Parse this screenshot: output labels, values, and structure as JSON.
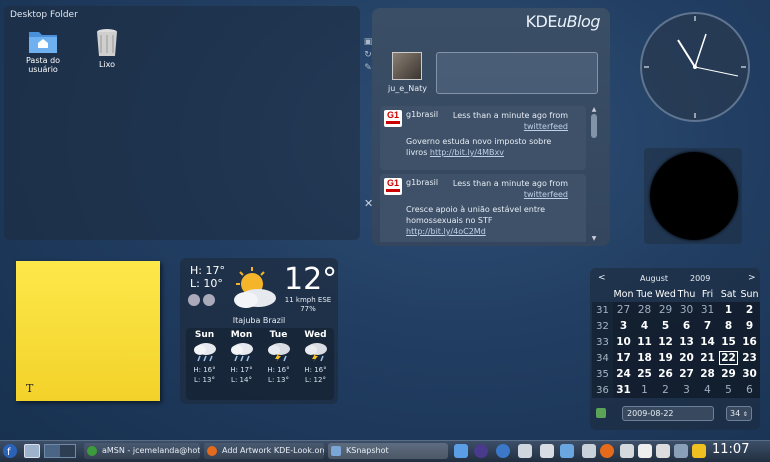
{
  "desktop_folder": {
    "title": "Desktop Folder",
    "icons": [
      {
        "label": "Pasta do usuário",
        "icon": "home-folder-icon"
      },
      {
        "label": "Lixo",
        "icon": "trash-icon"
      }
    ]
  },
  "microblog": {
    "logo_a": "KDE",
    "logo_b": "uBlog",
    "user": "ju_e_Naty",
    "posts": [
      {
        "user": "g1brasil",
        "time": "Less than a minute ago from",
        "source": "twitterfeed",
        "text": "Governo estuda novo imposto sobre livros",
        "link": "http://bit.ly/4MBxv"
      },
      {
        "user": "g1brasil",
        "time": "Less than a minute ago from",
        "source": "twitterfeed",
        "text": "Cresce apoio à união estável entre homossexuais no STF",
        "link": "http://bit.ly/4oC2Md"
      }
    ]
  },
  "weather": {
    "high": "H: 17°",
    "low": "L: 10°",
    "temp": "12°",
    "wind": "11 kmph ESE",
    "humidity": "77%",
    "city": "Itajuba Brazil",
    "days": [
      {
        "name": "Sun",
        "high": "H: 16°",
        "low": "L: 13°",
        "icon": "rain-icon"
      },
      {
        "name": "Mon",
        "high": "H: 17°",
        "low": "L: 14°",
        "icon": "rain-icon"
      },
      {
        "name": "Tue",
        "high": "H: 16°",
        "low": "L: 13°",
        "icon": "storm-icon"
      },
      {
        "name": "Wed",
        "high": "H: 16°",
        "low": "L: 12°",
        "icon": "storm-icon"
      }
    ]
  },
  "sticky": {
    "cursor": "T"
  },
  "calendar": {
    "prev": "<",
    "next": ">",
    "month": "August",
    "year": "2009",
    "headers": [
      "Mon",
      "Tue",
      "Wed",
      "Thu",
      "Fri",
      "Sat",
      "Sun"
    ],
    "weeks": [
      {
        "wk": "31",
        "days": [
          "27",
          "28",
          "29",
          "30",
          "31",
          "1",
          "2"
        ],
        "cur_from": 5
      },
      {
        "wk": "32",
        "days": [
          "3",
          "4",
          "5",
          "6",
          "7",
          "8",
          "9"
        ],
        "cur_from": 0
      },
      {
        "wk": "33",
        "days": [
          "10",
          "11",
          "12",
          "13",
          "14",
          "15",
          "16"
        ],
        "cur_from": 0
      },
      {
        "wk": "34",
        "days": [
          "17",
          "18",
          "19",
          "20",
          "21",
          "22",
          "23"
        ],
        "cur_from": 0
      },
      {
        "wk": "35",
        "days": [
          "24",
          "25",
          "26",
          "27",
          "28",
          "29",
          "30"
        ],
        "cur_from": 0
      },
      {
        "wk": "36",
        "days": [
          "31",
          "1",
          "2",
          "3",
          "4",
          "5",
          "6"
        ],
        "cur_from": 0,
        "cur_to": 1
      }
    ],
    "today": "22",
    "date_field": "2009-08-22",
    "week_field": "34"
  },
  "taskbar": {
    "tasks": [
      {
        "label": "aMSN - jcemelanda@hotm",
        "icon": "amsn-icon"
      },
      {
        "label": "Add Artwork KDE-Look.org",
        "icon": "firefox-icon"
      },
      {
        "label": "KSnapshot",
        "icon": "ksnapshot-icon"
      }
    ],
    "clock": "11:07"
  },
  "colors": {
    "accent": "#2f4f76",
    "sticky": "#fde84a",
    "link": "#bcd0e8"
  }
}
